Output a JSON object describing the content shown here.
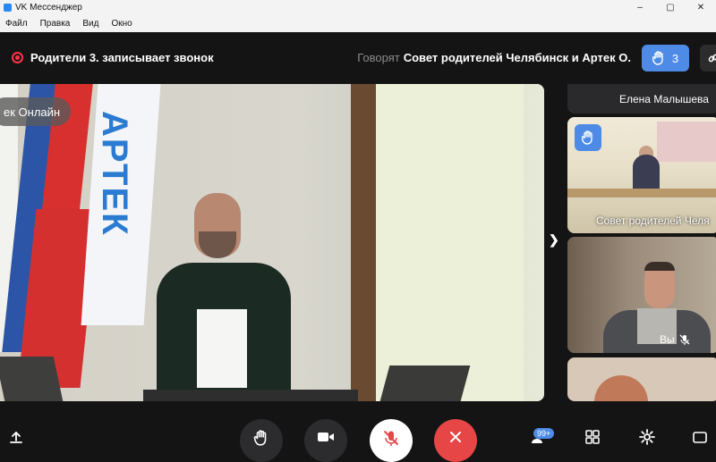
{
  "window": {
    "title": "VK Мессенджер",
    "minimize": "–",
    "maximize": "▢",
    "close": "✕"
  },
  "menu": [
    "Файл",
    "Правка",
    "Вид",
    "Окно"
  ],
  "callbar": {
    "recording_text": "Родители 3. записывает звонок",
    "speaking_prefix": "Говорят",
    "speaking_names": "Совет родителей Челябинск и Артек О.",
    "raised_hands_count": "3"
  },
  "main_video": {
    "label": "ек Онлайн",
    "flag_text": "АРТЕК"
  },
  "participants": [
    {
      "name": "Елена Малышева"
    },
    {
      "name": "Совет родителей Челя",
      "hand_raised": true
    },
    {
      "name": "Вы",
      "muted": true
    },
    {
      "name": ""
    }
  ],
  "controls": {
    "participants_badge": "99+"
  },
  "colors": {
    "accent": "#4d8be6",
    "record": "#ff3347",
    "hangup": "#e64646"
  }
}
